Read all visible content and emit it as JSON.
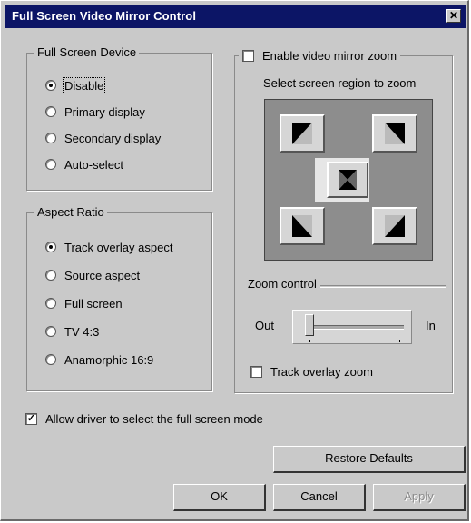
{
  "window": {
    "title": "Full Screen Video Mirror Control",
    "close_glyph": "✕"
  },
  "full_screen_device": {
    "legend": "Full Screen Device",
    "options": [
      {
        "label": "Disable",
        "selected": true
      },
      {
        "label": "Primary display",
        "selected": false
      },
      {
        "label": "Secondary display",
        "selected": false
      },
      {
        "label": "Auto-select",
        "selected": false
      }
    ]
  },
  "aspect_ratio": {
    "legend": "Aspect Ratio",
    "options": [
      {
        "label": "Track overlay aspect",
        "selected": true
      },
      {
        "label": "Source aspect",
        "selected": false
      },
      {
        "label": "Full screen",
        "selected": false
      },
      {
        "label": "TV 4:3",
        "selected": false
      },
      {
        "label": "Anamorphic 16:9",
        "selected": false
      }
    ]
  },
  "zoom": {
    "enable_label": "Enable video mirror zoom",
    "enable_checked": false,
    "region_label": "Select screen region to zoom",
    "zoom_control_label": "Zoom control",
    "out_label": "Out",
    "in_label": "In",
    "slider_value_fraction": 0.0,
    "track_overlay_label": "Track overlay zoom",
    "track_overlay_checked": false
  },
  "allow_driver": {
    "label": "Allow driver to select the full screen mode",
    "checked": true,
    "check_glyph": "✓"
  },
  "buttons": {
    "restore_defaults": "Restore Defaults",
    "ok": "OK",
    "cancel": "Cancel",
    "apply": "Apply"
  },
  "colors": {
    "titlebar": "#0c1566",
    "face": "#c9c9c9"
  }
}
